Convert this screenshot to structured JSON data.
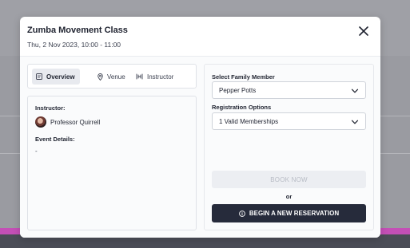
{
  "modal": {
    "title": "Zumba Movement Class",
    "subtitle": "Thu, 2 Nov 2023, 10:00 - 11:00",
    "close_icon": "close-icon"
  },
  "tabs": [
    {
      "label": "Overview",
      "icon": "document-icon",
      "active": true
    },
    {
      "label": "Venue",
      "icon": "location-pin-icon",
      "active": false
    },
    {
      "label": "Instructor",
      "icon": "instructor-icon",
      "active": false
    }
  ],
  "overview": {
    "instructor_label": "Instructor:",
    "instructor_name": "Professor Quirrell",
    "event_details_label": "Event Details:",
    "event_details_value": "-"
  },
  "booking": {
    "family_member_label": "Select Family Member",
    "family_member_value": "Pepper Potts",
    "registration_label": "Registration Options",
    "registration_value": "1 Valid Memberships",
    "book_now_label": "BOOK NOW",
    "or_label": "or",
    "begin_reservation_label": "BEGIN A NEW RESERVATION"
  },
  "colors": {
    "primary_button": "#262b3b",
    "disabled_button": "#eceef2",
    "accent_band": "#c44fb6",
    "footer": "#4b4d57"
  }
}
